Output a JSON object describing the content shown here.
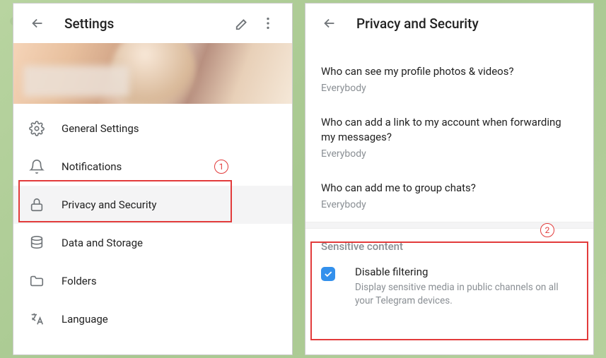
{
  "left": {
    "title": "Settings",
    "items": [
      {
        "label": "General Settings"
      },
      {
        "label": "Notifications"
      },
      {
        "label": "Privacy and Security"
      },
      {
        "label": "Data and Storage"
      },
      {
        "label": "Folders"
      },
      {
        "label": "Language"
      }
    ]
  },
  "right": {
    "title": "Privacy and Security",
    "privacy": [
      {
        "q": "Who can see my profile photos & videos?",
        "v": "Everybody"
      },
      {
        "q": "Who can add a link to my account when forwarding my messages?",
        "v": "Everybody"
      },
      {
        "q": "Who can add me to group chats?",
        "v": "Everybody"
      }
    ],
    "section": "Sensitive content",
    "disable_filtering": {
      "title": "Disable filtering",
      "desc": "Display sensitive media in public channels on all your Telegram devices.",
      "checked": true
    }
  },
  "annotations": {
    "one": "1",
    "two": "2"
  }
}
